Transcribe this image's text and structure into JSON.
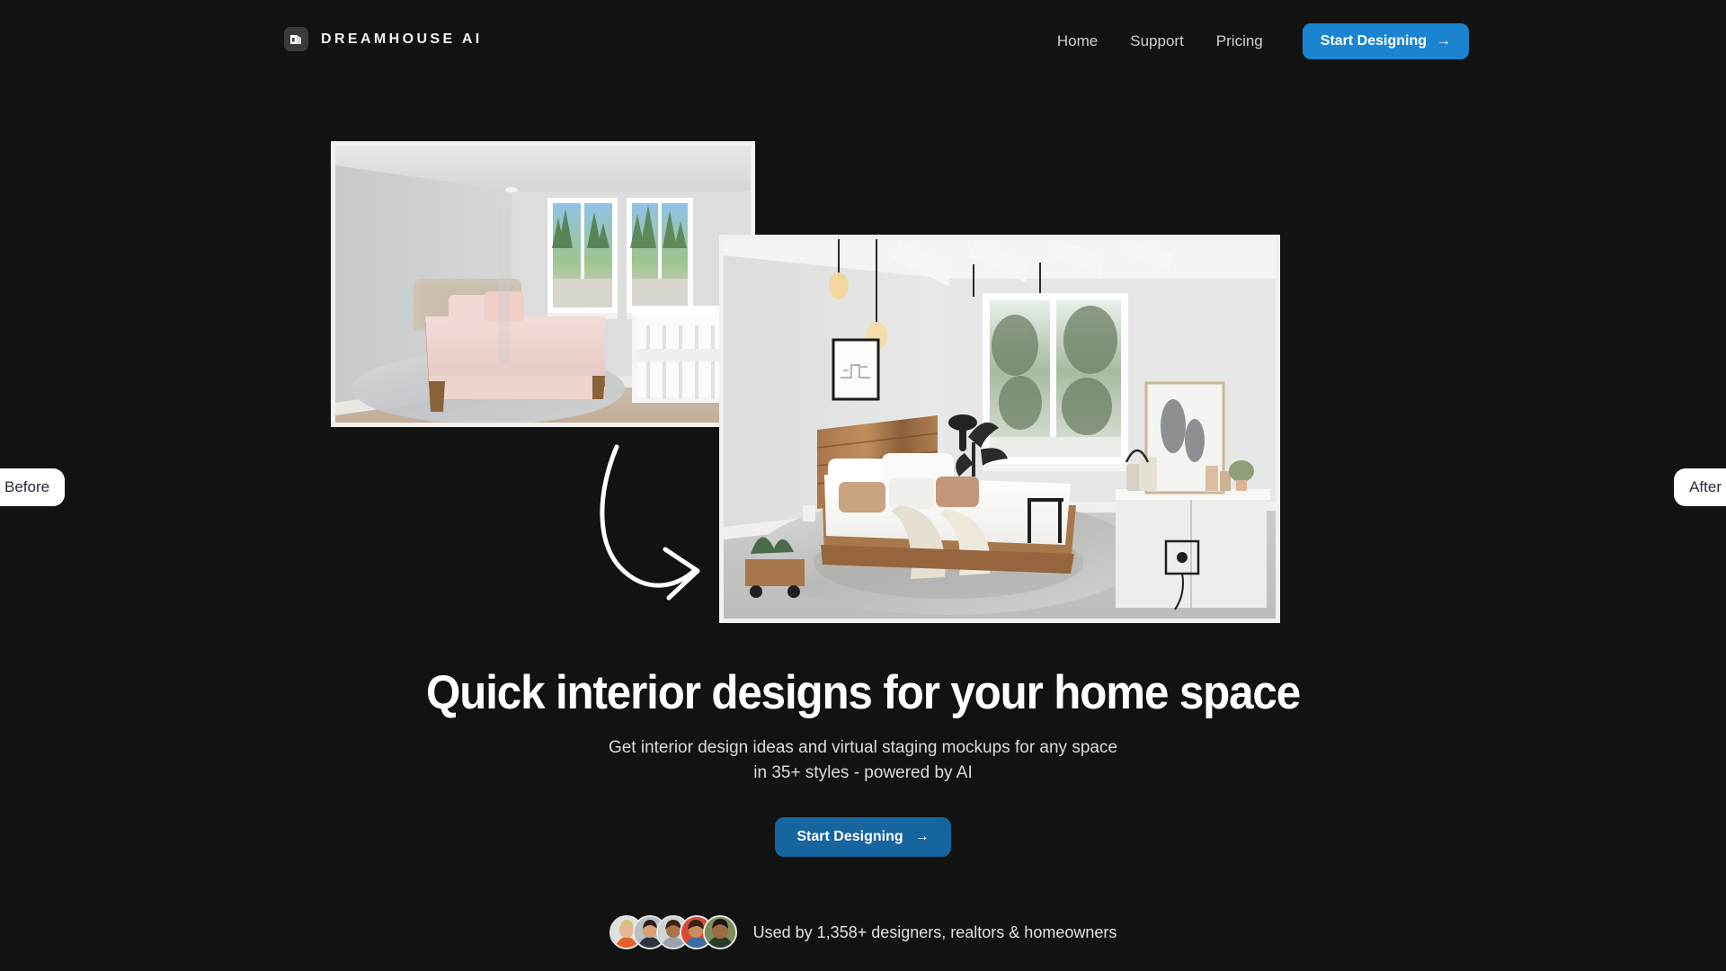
{
  "theme": {
    "background": "#121212",
    "header_cta_blue": "#1a84d0",
    "hero_cta_blue": "#17659f",
    "pill_bg": "#ffffff",
    "pill_text": "#262b3c",
    "headline_color": "#ffffff",
    "subline_color": "#dcdcdc",
    "photo_frame": "#f2f1ef"
  },
  "header": {
    "brand_name": "DREAMHOUSE AI",
    "brand_icon": "dreamhouse-logo-icon",
    "nav": [
      {
        "label": "Home"
      },
      {
        "label": "Support"
      },
      {
        "label": "Pricing"
      }
    ],
    "cta": {
      "label": "Start Designing",
      "icon": "arrow-right-icon",
      "arrow": "→"
    }
  },
  "showcase": {
    "before_pill": "Before",
    "after_pill": "After",
    "arrow_icon": "curved-arrow-icon",
    "before_image": {
      "alt": "Empty staged bedroom with pink bedding, two windows and a white crib",
      "name": "before-room-photo"
    },
    "after_image": {
      "alt": "Redesigned loft bedroom with reclaimed wood bed, pendant bulbs and cabinet",
      "name": "after-room-photo"
    }
  },
  "hero": {
    "headline": "Quick interior designs for your home space",
    "subline_1": "Get interior design ideas and virtual staging mockups for any space",
    "subline_2": "in 35+ styles - powered by AI",
    "cta": {
      "label": "Start Designing",
      "icon": "arrow-right-icon",
      "arrow": "→"
    }
  },
  "social_proof": {
    "text": "Used by 1,358+ designers, realtors & homeowners",
    "avatar_count": 5,
    "avatars": [
      {
        "name": "avatar-1",
        "skin": "#e8b894",
        "hair": "#d8c07a",
        "shirt": "#e2622a",
        "bg": "#dfe3e0"
      },
      {
        "name": "avatar-2",
        "skin": "#d9a173",
        "hair": "#2a1f18",
        "shirt": "#2d3440",
        "bg": "#b9bfc4"
      },
      {
        "name": "avatar-3",
        "skin": "#a9734a",
        "hair": "#3a2416",
        "shirt": "#9aa3ad",
        "bg": "#cfd6d4"
      },
      {
        "name": "avatar-4",
        "skin": "#c98d60",
        "hair": "#3b2014",
        "shirt": "#3b6ea5",
        "bg": "#d94b35"
      },
      {
        "name": "avatar-5",
        "skin": "#9d6a43",
        "hair": "#1d1410",
        "shirt": "#2b3a2e",
        "bg": "#7a8f58"
      }
    ]
  }
}
